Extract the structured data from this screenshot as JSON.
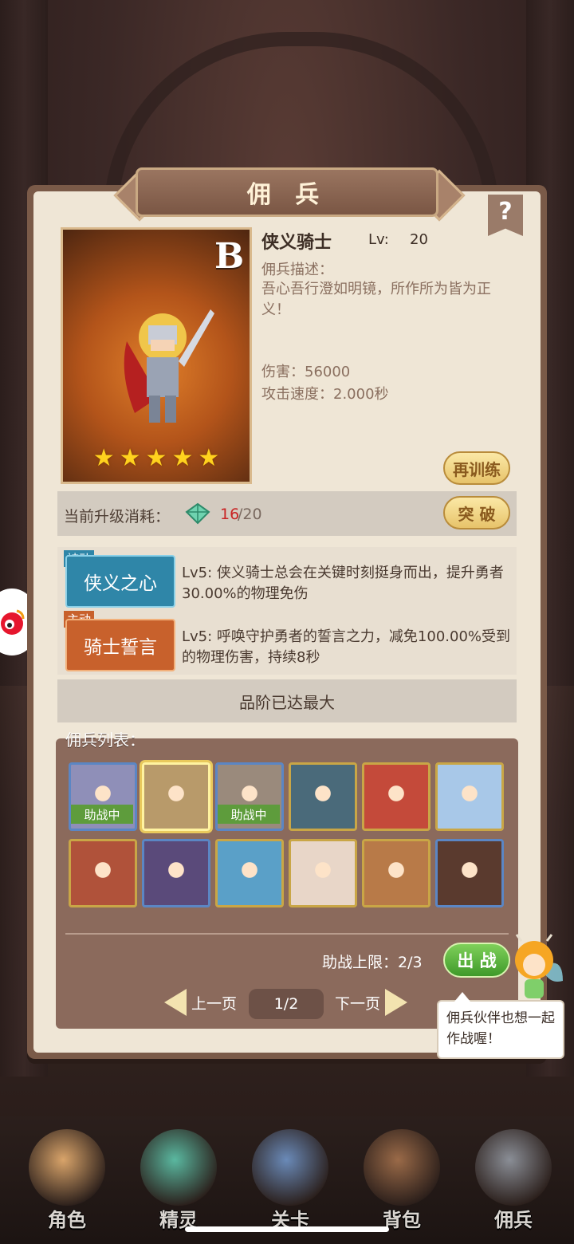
{
  "header": {
    "title": "佣 兵",
    "help_label": "?"
  },
  "hero": {
    "rank": "B",
    "name": "侠义骑士",
    "lv_label": "Lv:",
    "lv_value": "20",
    "stars": 5,
    "desc_label": "佣兵描述：",
    "desc": "吾心吾行澄如明镜，所作所为皆为正义！",
    "damage": "伤害：56000",
    "attack_speed": "攻击速度：2.000秒",
    "retrain_label": "再训练"
  },
  "upgrade": {
    "cost_label": "当前升级消耗：",
    "have": "16",
    "need": "/20",
    "breakthrough_label": "突 破"
  },
  "skills": [
    {
      "type": "被动",
      "name": "侠义之心",
      "text": "Lv5:  侠义骑士总会在关键时刻挺身而出，提升勇者30.00%的物理免伤",
      "color": "#2f86a8"
    },
    {
      "type": "主动",
      "name": "骑士誓言",
      "text": "Lv5:  呼唤守护勇者的誓言之力，减免100.00%受到的物理伤害，持续8秒",
      "color": "#c8612c"
    }
  ],
  "quality_max": "品阶已达最大",
  "list": {
    "title": "佣兵列表：",
    "assist_tag": "助战中",
    "cards": [
      {
        "icon": "demon-girl-portrait",
        "assist": true,
        "frame": "blue",
        "bg": "#8f8fb8"
      },
      {
        "icon": "knight-portrait",
        "assist": false,
        "frame": "sel",
        "bg": "#b89a6a"
      },
      {
        "icon": "warrior-portrait",
        "assist": true,
        "frame": "blue",
        "bg": "#9a8a7c"
      },
      {
        "icon": "ninja-portrait",
        "assist": false,
        "frame": "gold",
        "bg": "#4a6a7a"
      },
      {
        "icon": "red-hair-portrait",
        "assist": false,
        "frame": "gold",
        "bg": "#c44a3a"
      },
      {
        "icon": "ice-maiden-portrait",
        "assist": false,
        "frame": "gold",
        "bg": "#a8c8e8"
      },
      {
        "icon": "blonde-demon-portrait",
        "assist": false,
        "frame": "gold",
        "bg": "#b0523a"
      },
      {
        "icon": "elf-mage-portrait",
        "assist": false,
        "frame": "blue",
        "bg": "#5a4a7a"
      },
      {
        "icon": "elf-archer-portrait",
        "assist": false,
        "frame": "gold",
        "bg": "#5aa0c8"
      },
      {
        "icon": "white-hair-portrait",
        "assist": false,
        "frame": "gold",
        "bg": "#e8d6c8"
      },
      {
        "icon": "dwarf-portrait",
        "assist": false,
        "frame": "gold",
        "bg": "#b87a48"
      },
      {
        "icon": "brute-portrait",
        "assist": false,
        "frame": "blue",
        "bg": "#5a3a2e"
      }
    ],
    "assist_limit": "助战上限：2/3",
    "deploy_label": "出 战",
    "prev_label": "上一页",
    "next_label": "下一页",
    "page": "1/2"
  },
  "tip_bubble": "佣兵伙伴也想一起作战喔！",
  "nav": [
    {
      "label": "角色",
      "icon": "hero-icon"
    },
    {
      "label": "精灵",
      "icon": "spirit-icon"
    },
    {
      "label": "关卡",
      "icon": "stage-icon"
    },
    {
      "label": "背包",
      "icon": "backpack-icon"
    },
    {
      "label": "佣兵",
      "icon": "mercenary-icon"
    }
  ]
}
